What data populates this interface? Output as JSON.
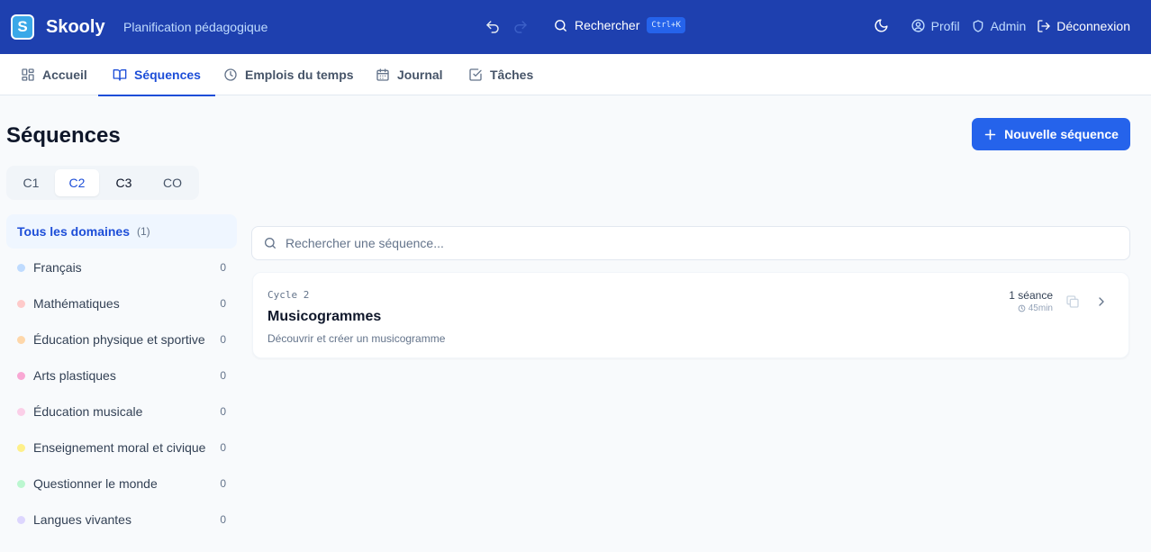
{
  "header": {
    "logo_letter": "S",
    "app_name": "Skooly",
    "subtitle": "Planification pédagogique",
    "search_label": "Rechercher",
    "shortcut": "Ctrl+K",
    "profile": "Profil",
    "admin": "Admin",
    "logout": "Déconnexion"
  },
  "nav": {
    "tabs": [
      {
        "label": "Accueil",
        "icon": "grid-icon"
      },
      {
        "label": "Séquences",
        "icon": "book-icon"
      },
      {
        "label": "Emplois du temps",
        "icon": "clock-icon"
      },
      {
        "label": "Journal",
        "icon": "calendar-icon"
      },
      {
        "label": "Tâches",
        "icon": "checkbox-icon"
      }
    ],
    "active": "Séquences"
  },
  "page": {
    "title": "Séquences",
    "new_button": "Nouvelle séquence"
  },
  "cycles": {
    "items": [
      "C1",
      "C2",
      "C3",
      "CO"
    ],
    "selected": "C2"
  },
  "domains": {
    "all_label": "Tous les domaines",
    "all_count": "(1)",
    "items": [
      {
        "label": "Français",
        "count": "0",
        "color": "#bfdbfe"
      },
      {
        "label": "Mathématiques",
        "count": "0",
        "color": "#fecaca"
      },
      {
        "label": "Éducation physique et sportive",
        "count": "0",
        "color": "#fed7aa"
      },
      {
        "label": "Arts plastiques",
        "count": "0",
        "color": "#f9a8d4"
      },
      {
        "label": "Éducation musicale",
        "count": "0",
        "color": "#fbcfe8"
      },
      {
        "label": "Enseignement moral et civique",
        "count": "0",
        "color": "#fef08a"
      },
      {
        "label": "Questionner le monde",
        "count": "0",
        "color": "#bbf7d0"
      },
      {
        "label": "Langues vivantes",
        "count": "0",
        "color": "#ddd6fe"
      }
    ]
  },
  "search": {
    "placeholder": "Rechercher une séquence..."
  },
  "sequences": [
    {
      "cycle": "Cycle 2",
      "title": "Musicogrammes",
      "description": "Découvrir et créer un musicogramme",
      "sessions": "1 séance",
      "duration": "45min"
    }
  ],
  "colors": {
    "header_bg": "#1e40af",
    "accent": "#2563eb",
    "active_text": "#1d4ed8"
  }
}
